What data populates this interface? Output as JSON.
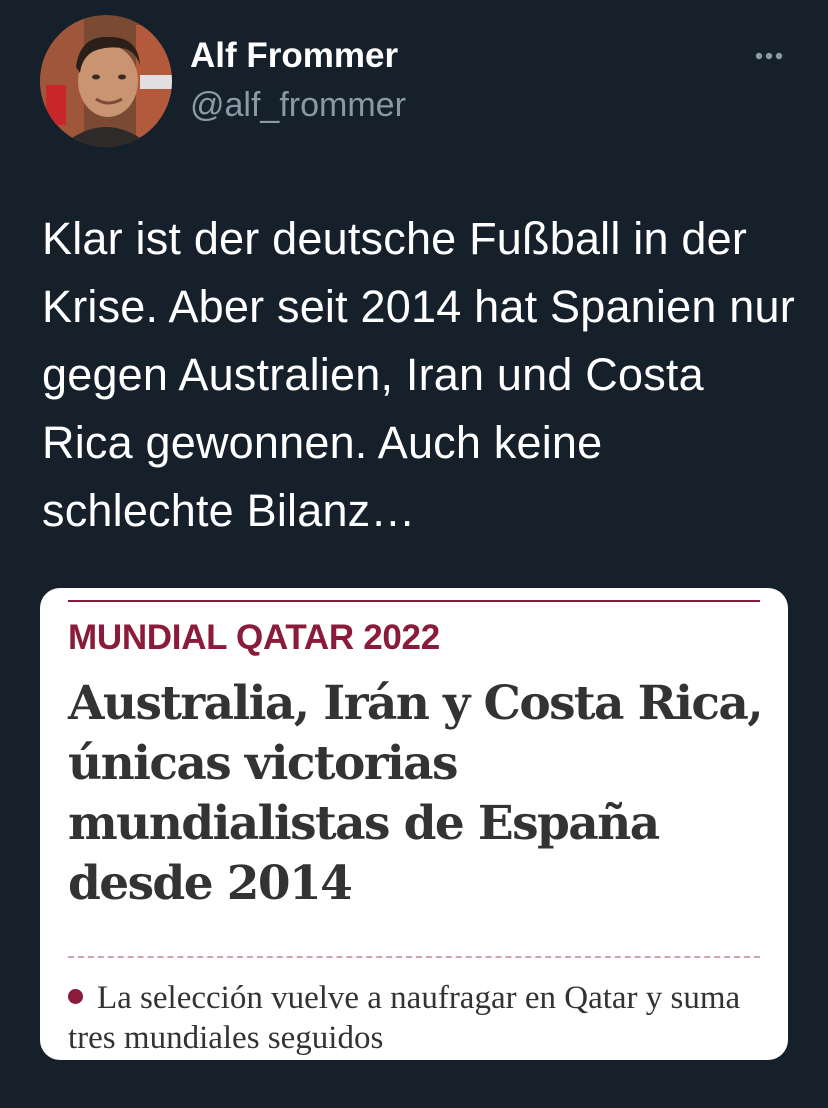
{
  "author": {
    "display_name": "Alf Frommer",
    "handle": "@alf_frommer"
  },
  "tweet": {
    "text": "Klar ist der deutsche Fußball in der Krise. Aber seit 2014 hat Spanien nur gegen Australien, Iran und Costa Rica gewonnen. Auch keine schlechte Bilanz…"
  },
  "card": {
    "kicker": "MUNDIAL QATAR 2022",
    "headline": "Australia, Irán y Costa Rica, únicas victorias mundialistas de España desde 2014",
    "bullet": "La selección vuelve a naufragar en Qatar y suma tres mundiales seguidos"
  },
  "icons": {
    "more": "more-horizontal-icon",
    "avatar": "user-avatar"
  },
  "colors": {
    "background": "#15202b",
    "text": "#ffffff",
    "secondary_text": "#8b98a5",
    "card_accent": "#8b1b3a",
    "card_text": "#333333"
  }
}
